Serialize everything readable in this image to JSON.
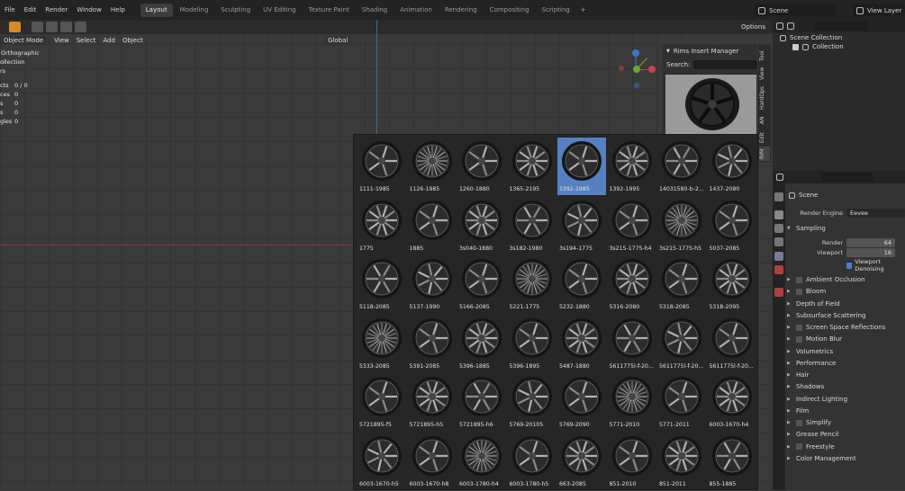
{
  "menubar": {
    "items": [
      "File",
      "Edit",
      "Render",
      "Window",
      "Help"
    ],
    "workspaces": [
      "Layout",
      "Modeling",
      "Sculpting",
      "UV Editing",
      "Texture Paint",
      "Shading",
      "Animation",
      "Rendering",
      "Compositing",
      "Scripting"
    ],
    "active_workspace": "Layout",
    "plus": "+",
    "scene": "Scene",
    "view_layer": "View Layer"
  },
  "viewport": {
    "mode": "Object Mode",
    "menus": [
      "View",
      "Select",
      "Add",
      "Object"
    ],
    "transform": "Global",
    "options": "Options",
    "overlay_lines": [
      "Orthographic",
      "ollection",
      "rs"
    ],
    "stats": [
      {
        "label": "cts",
        "value": "0 / 0"
      },
      {
        "label": "ces",
        "value": "0"
      },
      {
        "label": "s",
        "value": "0"
      },
      {
        "label": "s",
        "value": "0"
      },
      {
        "label": "gles",
        "value": "0"
      }
    ]
  },
  "rims_panel": {
    "title": "Rims Insert Manager",
    "search_label": "Search:"
  },
  "nside_tabs": [
    "Tool",
    "View",
    "HardOps",
    "AN",
    "Edit",
    "RIM"
  ],
  "gallery": {
    "selected_index": 4,
    "items": [
      "1111-1985",
      "1126-1985",
      "1260-1880",
      "1365-2195",
      "1392-1985",
      "1392-1995",
      "14031580-b-2...",
      "1437-2080",
      "1775",
      "1885",
      "3s040-1880",
      "3s182-1980",
      "3s194-1775",
      "3s215-1775-h4",
      "3s215-1775-h5",
      "5037-2085",
      "5118-2085",
      "5137-1990",
      "5166-2085",
      "5221-1775",
      "5232-1880",
      "5316-2080",
      "5318-2085",
      "5318-2095",
      "5333-2085",
      "5391-2085",
      "5396-1885",
      "5396-1895",
      "5487-1880",
      "5611775l-f-20...",
      "5611775l-f-20...",
      "5611775l-f-20...",
      "5721895-f5",
      "5721895-h5",
      "5721895-h6",
      "5769-20105",
      "5769-2090",
      "5771-2010",
      "5771-2011",
      "6003-1670-h4",
      "6003-1670-h5",
      "6003-1670-h8",
      "6003-1780-h4",
      "6003-1780-h5",
      "663-2085",
      "851-2010",
      "851-2011",
      "855-1885"
    ]
  },
  "outliner": {
    "scene_collection": "Scene Collection",
    "collection": "Collection"
  },
  "properties": {
    "context": "Scene",
    "render_engine_label": "Render Engine",
    "render_engine_value": "Eevee",
    "sampling": "Sampling",
    "render_label": "Render",
    "render_value": "64",
    "viewport_label": "Viewport",
    "viewport_value": "16",
    "denoising": "Viewport Denoising",
    "panels": [
      {
        "label": "Ambient Occlusion",
        "check": true
      },
      {
        "label": "Bloom",
        "check": true
      },
      {
        "label": "Depth of Field",
        "check": false
      },
      {
        "label": "Subsurface Scattering",
        "check": false
      },
      {
        "label": "Screen Space Reflections",
        "check": true
      },
      {
        "label": "Motion Blur",
        "check": true
      },
      {
        "label": "Volumetrics",
        "check": false
      },
      {
        "label": "Performance",
        "check": false
      },
      {
        "label": "Hair",
        "check": false
      },
      {
        "label": "Shadows",
        "check": false
      },
      {
        "label": "Indirect Lighting",
        "check": false
      },
      {
        "label": "Film",
        "check": false
      },
      {
        "label": "Simplify",
        "check": true
      },
      {
        "label": "Grease Pencil",
        "check": false
      },
      {
        "label": "Freestyle",
        "check": true
      },
      {
        "label": "Color Management",
        "check": false
      }
    ]
  },
  "colors": {
    "accent_selected": "#5680c2",
    "x_axis": "#c8424a",
    "y_axis": "#6aaa30",
    "z_axis": "#3b78c8"
  }
}
